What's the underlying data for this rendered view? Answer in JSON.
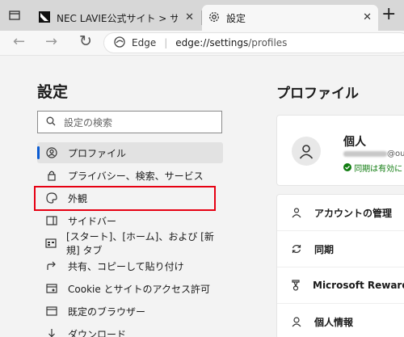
{
  "tabs": [
    {
      "title": "NEC LAVIE公式サイト > サービス&サ"
    },
    {
      "title": "設定"
    }
  ],
  "address": {
    "edge_label": "Edge",
    "url_host": "edge://settings",
    "url_path": "/profiles"
  },
  "settings": {
    "title": "設定",
    "search_placeholder": "設定の検索",
    "nav": [
      {
        "label": "プロファイル",
        "icon": "profile-icon",
        "selected": true
      },
      {
        "label": "プライバシー、検索、サービス",
        "icon": "lock-icon"
      },
      {
        "label": "外観",
        "icon": "palette-icon",
        "highlighted": true
      },
      {
        "label": "サイドバー",
        "icon": "sidebar-icon"
      },
      {
        "label": "[スタート]、[ホーム]、および [新規] タブ",
        "icon": "home-tabs-icon"
      },
      {
        "label": "共有、コピーして貼り付け",
        "icon": "share-icon"
      },
      {
        "label": "Cookie とサイトのアクセス許可",
        "icon": "cookie-icon"
      },
      {
        "label": "既定のブラウザー",
        "icon": "browser-icon"
      },
      {
        "label": "ダウンロード",
        "icon": "download-icon"
      }
    ]
  },
  "profile": {
    "title": "プロファイル",
    "name": "個人",
    "email_suffix": "@ou",
    "sync_status": "同期は有効に",
    "menu": [
      {
        "label": "アカウントの管理",
        "icon": "account-icon"
      },
      {
        "label": "同期",
        "icon": "sync-icon"
      },
      {
        "label": "Microsoft Rewards",
        "icon": "rewards-icon"
      },
      {
        "label": "個人情報",
        "icon": "personal-info-icon"
      }
    ]
  },
  "colors": {
    "accent": "#0a5bd3",
    "highlight": "#e60012",
    "sync_ok": "#107c10"
  }
}
